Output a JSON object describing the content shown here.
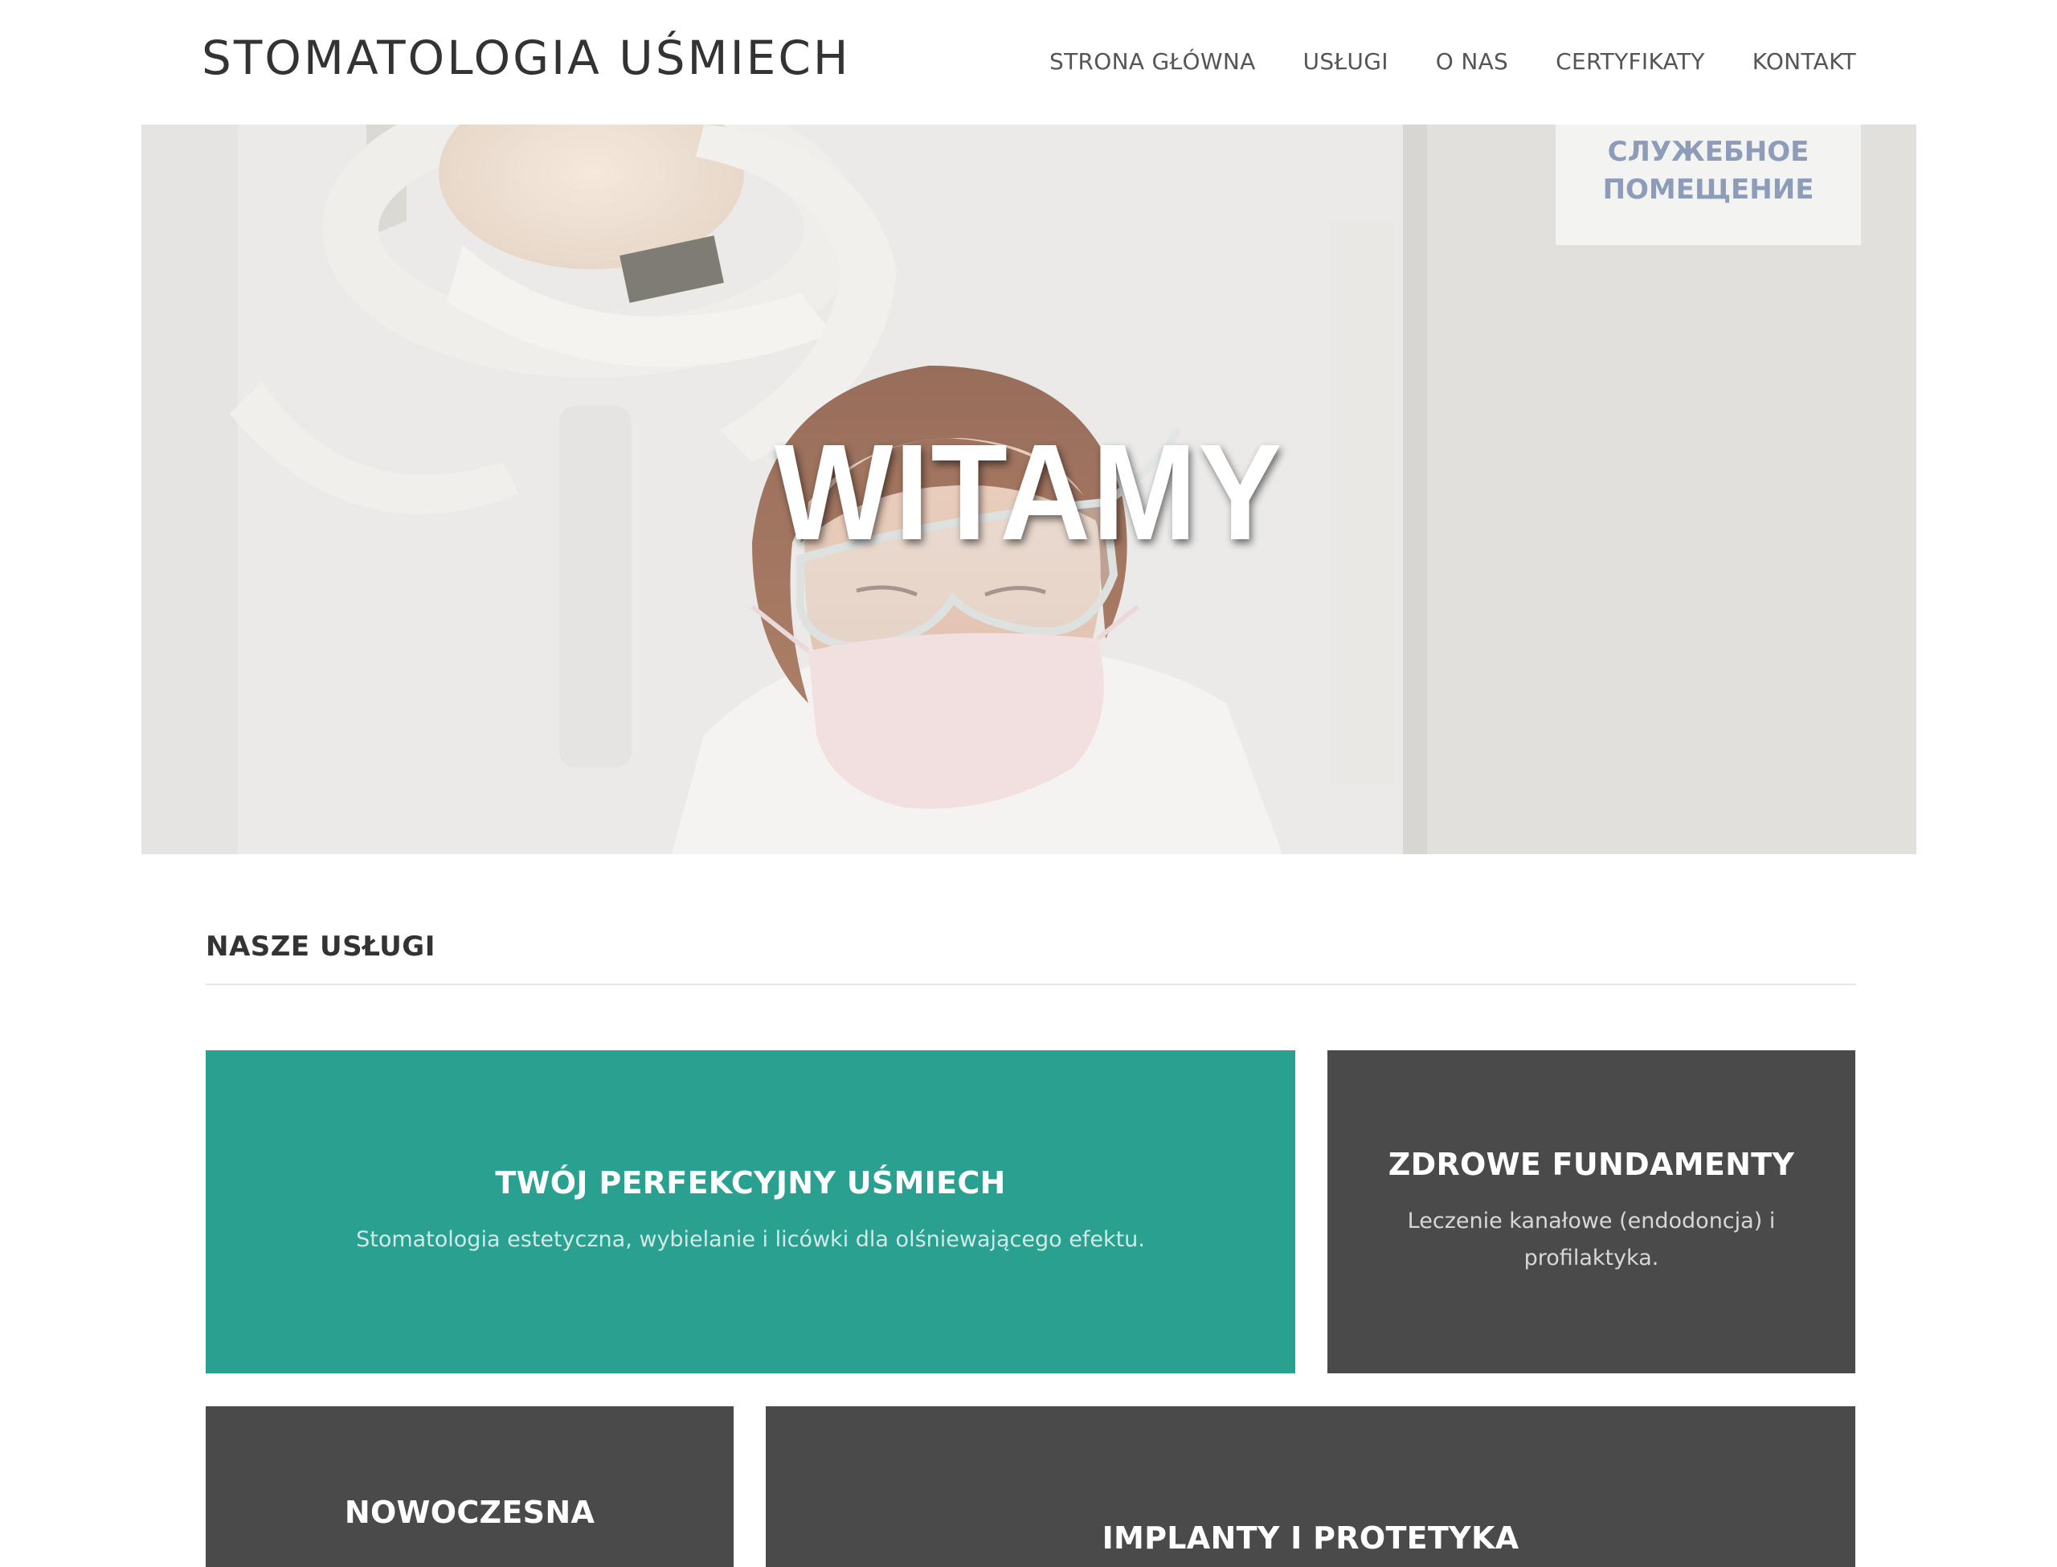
{
  "header": {
    "brand": "STOMATOLOGIA UŚMIECH",
    "nav": [
      "STRONA GŁÓWNA",
      "USŁUGI",
      "O NAS",
      "CERTYFIKATY",
      "KONTAKT"
    ]
  },
  "hero": {
    "title": "WITAMY",
    "sign_text_line1": "СЛУЖЕБНОЕ",
    "sign_text_line2": "ПОМЕЩЕНИЕ"
  },
  "services": {
    "heading": "NASZE USŁUGI",
    "tiles": [
      {
        "title": "TWÓJ PERFEKCYJNY UŚMIECH",
        "desc": "Stomatologia estetyczna, wybielanie i licówki dla olśniewającego efektu.",
        "color": "#2aa090"
      },
      {
        "title": "ZDROWE FUNDAMENTY",
        "desc": "Leczenie kanałowe (endodoncja) i profilaktyka.",
        "color": "#4a4a4a"
      },
      {
        "title": "NOWOCZESNA",
        "desc": "",
        "color": "#4a4a4a"
      },
      {
        "title": "IMPLANTY I PROTETYKA",
        "desc": "",
        "color": "#4a4a4a"
      }
    ]
  },
  "colors": {
    "accent": "#2aa090",
    "dark_tile": "#4a4a4a",
    "text": "#333333"
  }
}
